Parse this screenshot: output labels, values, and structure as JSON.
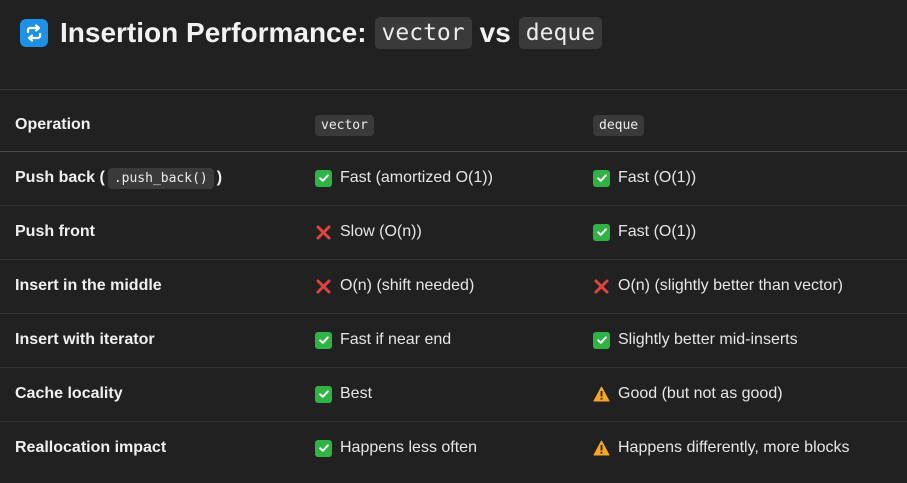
{
  "heading": {
    "icon": "repeat-icon",
    "title_prefix": "Insertion Performance:",
    "code_a": "vector",
    "joiner": "vs",
    "code_b": "deque"
  },
  "table": {
    "headers": [
      "Operation",
      "vector",
      "deque"
    ],
    "rows": [
      {
        "op_text": "Push back (",
        "op_code": ".push_back()",
        "op_suffix": ")",
        "vector": {
          "status": "check",
          "text": "Fast (amortized O(1))"
        },
        "deque": {
          "status": "check",
          "text": "Fast (O(1))"
        }
      },
      {
        "op_text": "Push front",
        "vector": {
          "status": "cross",
          "text": "Slow (O(n))"
        },
        "deque": {
          "status": "check",
          "text": "Fast (O(1))"
        }
      },
      {
        "op_text": "Insert in the middle",
        "vector": {
          "status": "cross",
          "text": "O(n) (shift needed)"
        },
        "deque": {
          "status": "cross",
          "text": "O(n) (slightly better than vector)"
        }
      },
      {
        "op_text": "Insert with iterator",
        "vector": {
          "status": "check",
          "text": "Fast if near end"
        },
        "deque": {
          "status": "check",
          "text": "Slightly better mid-inserts"
        }
      },
      {
        "op_text": "Cache locality",
        "vector": {
          "status": "check",
          "text": "Best"
        },
        "deque": {
          "status": "warning",
          "text": "Good (but not as good)"
        }
      },
      {
        "op_text": "Reallocation impact",
        "vector": {
          "status": "check",
          "text": "Happens less often"
        },
        "deque": {
          "status": "warning",
          "text": "Happens differently, more blocks"
        }
      }
    ]
  },
  "colors": {
    "background": "#212121",
    "check": "#2fb344",
    "cross": "#e0443e",
    "warning": "#f5a623",
    "icon_blue": "#1e90e6"
  }
}
